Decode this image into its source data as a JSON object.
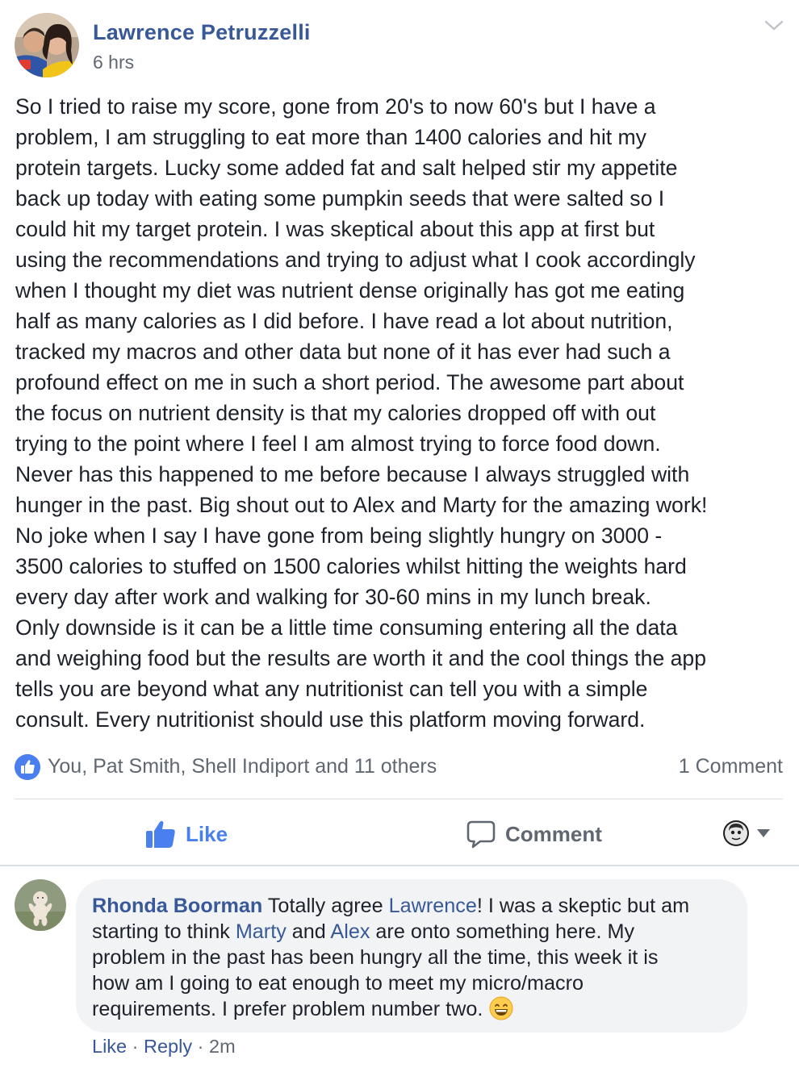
{
  "post": {
    "author": "Lawrence Petruzzelli",
    "timestamp": "6 hrs",
    "body_lines": [
      "So I tried to raise my score, gone from 20's to now 60's but I have a",
      "problem, I am struggling to eat more than 1400 calories and hit my",
      "protein targets. Lucky some added fat and salt helped stir my appetite",
      "back up today with eating some pumpkin seeds that were salted so I",
      "could hit my target protein. I was skeptical about this app at first but",
      "using the recommendations and trying to adjust what I cook accordingly",
      "when I thought my diet was nutrient dense originally has got me eating",
      "half as many calories as I did before. I have read a lot about nutrition,",
      "tracked my macros and other data but none of it has ever had such a",
      "profound effect on me in such a short period. The awesome part about",
      "the focus on nutrient density is that my calories dropped off with out",
      "trying to the point where I feel I am almost trying to force food down.",
      "Never has this happened to me before because I always struggled with",
      "hunger in the past. Big shout out to Alex and Marty for the amazing work!",
      "No joke when I say I have gone from being slightly hungry on 3000 -",
      "3500 calories to stuffed on 1500 calories whilst hitting the weights hard",
      "every day after work and walking for 30-60 mins in my lunch break.",
      "Only downside is it can be a little time consuming entering all the data",
      "and weighing food but the results are worth it and the cool things the app",
      "tells you are beyond what any nutritionist can tell you with a simple",
      "consult. Every nutritionist should use this platform moving forward."
    ],
    "reactions_text": "You, Pat Smith, Shell Indiport and 11 others",
    "comment_count": "1 Comment"
  },
  "actions": {
    "like_label": "Like",
    "comment_label": "Comment"
  },
  "comment": {
    "author": "Rhonda Boorman",
    "line1_a": " Totally agree ",
    "mention1": "Lawrence",
    "line1_b": "! I was a skeptic but am",
    "line2_a": "starting to think ",
    "mention2": "Marty",
    "line2_b": " and ",
    "mention3": "Alex",
    "line2_c": " are onto something here. My",
    "line3": "problem in the past has been hungry all the time, this week it is",
    "line4": "how am I going to eat enough to meet my micro/macro",
    "line5": "requirements. I prefer problem number two.",
    "emoji": "grinning-face-emoji",
    "like_label": "Like",
    "sep": " · ",
    "reply_label": "Reply",
    "time": "2m"
  },
  "colors": {
    "link_blue": "#385898",
    "like_blue": "#4a7ff0",
    "meta_gray": "#606770",
    "bubble_bg": "#f2f3f5"
  }
}
